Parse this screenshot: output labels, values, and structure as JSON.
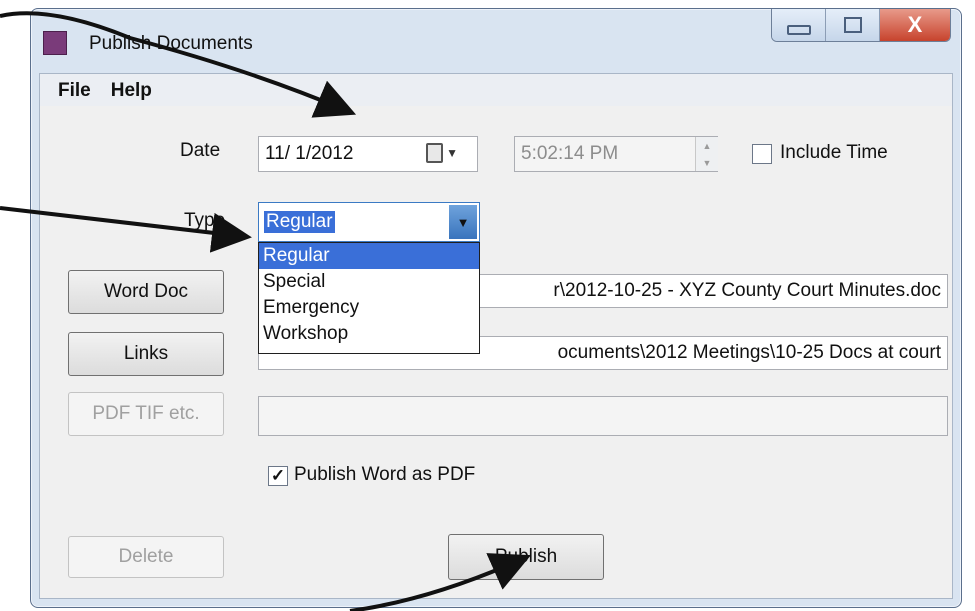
{
  "window": {
    "title": "Publish Documents",
    "close_glyph": "X",
    "min_icon": "minimize-icon",
    "max_icon": "maximize-icon"
  },
  "menu": {
    "items": [
      "File",
      "Help"
    ]
  },
  "date": {
    "label": "Date",
    "value": "11/ 1/2012",
    "calendar_icon": "calendar-icon",
    "time_value": "5:02:14 PM",
    "include_time_label": "Include Time",
    "include_time_checked": false
  },
  "type": {
    "label": "Type",
    "selected": "Regular",
    "options": [
      "Regular",
      "Special",
      "Emergency",
      "Workshop"
    ]
  },
  "word_doc": {
    "button": "Word Doc",
    "path": "r\\2012-10-25 - XYZ County Court Minutes.doc"
  },
  "links": {
    "button": "Links",
    "path": "ocuments\\2012 Meetings\\10-25 Docs at court"
  },
  "pdf": {
    "button": "PDF TIF etc.",
    "path": ""
  },
  "publish_word_as_pdf": {
    "label": "Publish Word as PDF",
    "checked": true,
    "glyph": "✓"
  },
  "buttons": {
    "delete": "Delete",
    "publish": "Publish"
  },
  "colors": {
    "selection": "#3a6fd8",
    "window_frame": "#d9e4f1",
    "close": "#c7432d"
  }
}
